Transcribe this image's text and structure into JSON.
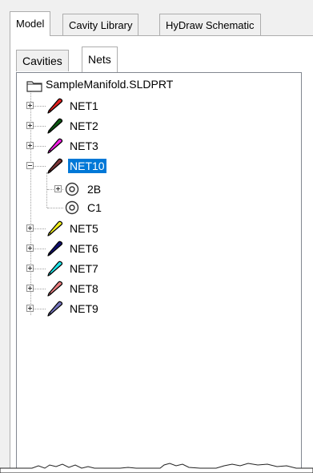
{
  "top_tabs": [
    {
      "label": "Model",
      "active": true
    },
    {
      "label": "Cavity Library",
      "active": false
    },
    {
      "label": "HyDraw Schematic",
      "active": false
    }
  ],
  "sub_tabs": [
    {
      "label": "Cavities",
      "active": false
    },
    {
      "label": "Nets",
      "active": true
    }
  ],
  "tree": {
    "root": {
      "label": "SampleManifold.SLDPRT",
      "icon": "part-file-icon"
    },
    "nets": [
      {
        "label": "NET1",
        "color": "#e0201e",
        "expanded": false
      },
      {
        "label": "NET2",
        "color": "#0b5a12",
        "expanded": false
      },
      {
        "label": "NET3",
        "color": "#f21ee3",
        "expanded": false
      },
      {
        "label": "NET10",
        "color": "#7a3536",
        "expanded": true,
        "selected": true,
        "children": [
          {
            "label": "2B",
            "icon": "cavity-icon",
            "expandable": true
          },
          {
            "label": "C1",
            "icon": "cavity-icon",
            "expandable": false
          }
        ]
      },
      {
        "label": "NET5",
        "color": "#f1ee1c",
        "expanded": false
      },
      {
        "label": "NET6",
        "color": "#10106e",
        "expanded": false
      },
      {
        "label": "NET7",
        "color": "#1ee3e8",
        "expanded": false
      },
      {
        "label": "NET8",
        "color": "#ea7c7e",
        "expanded": false
      },
      {
        "label": "NET9",
        "color": "#7474bc",
        "expanded": false
      }
    ]
  }
}
